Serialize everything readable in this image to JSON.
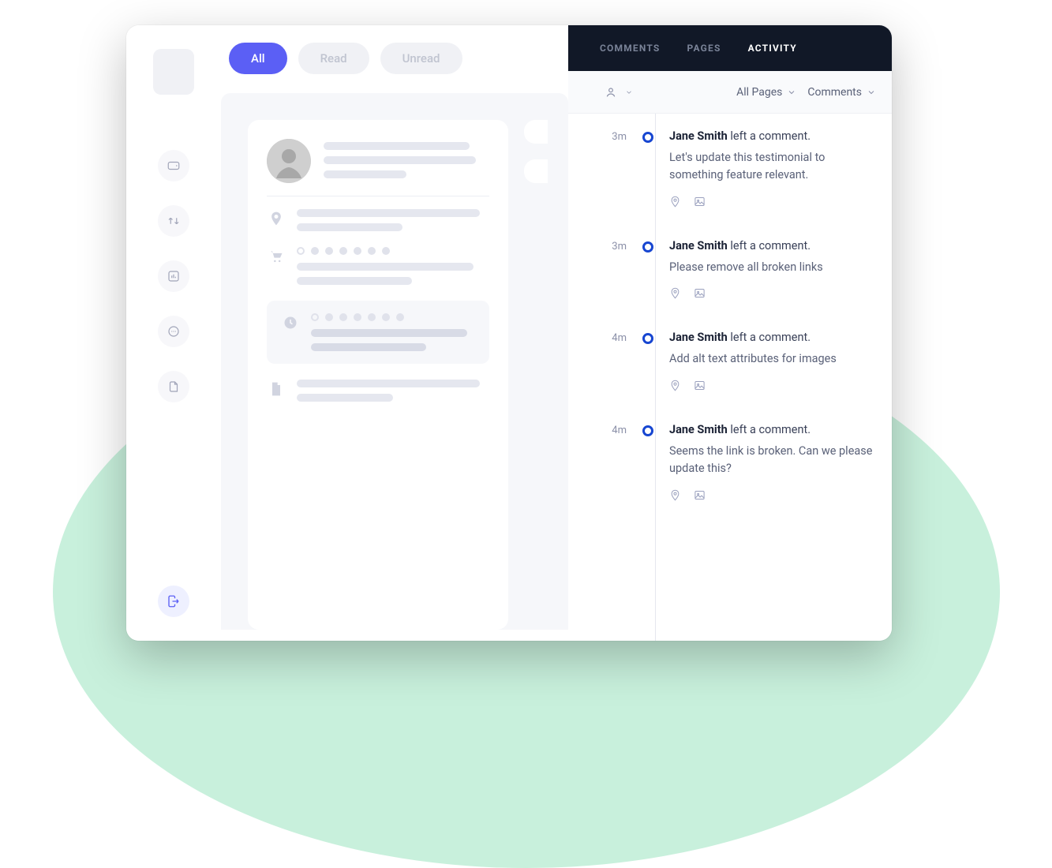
{
  "filters": {
    "all": "All",
    "read": "Read",
    "unread": "Unread"
  },
  "panel": {
    "tabs": {
      "comments": "COMMENTS",
      "pages": "PAGES",
      "activity": "ACTIVITY"
    },
    "dropdowns": {
      "pages": "All Pages",
      "type": "Comments"
    }
  },
  "activity": [
    {
      "time": "3m",
      "author": "Jane Smith",
      "action": "left a comment.",
      "text": "Let's update this testimonial to something feature relevant."
    },
    {
      "time": "3m",
      "author": "Jane Smith",
      "action": "left a comment.",
      "text": "Please remove all broken links"
    },
    {
      "time": "4m",
      "author": "Jane Smith",
      "action": "left a comment.",
      "text": "Add alt text attributes for images"
    },
    {
      "time": "4m",
      "author": "Jane Smith",
      "action": "left a comment.",
      "text": "Seems the link is broken. Can we please update this?"
    }
  ]
}
